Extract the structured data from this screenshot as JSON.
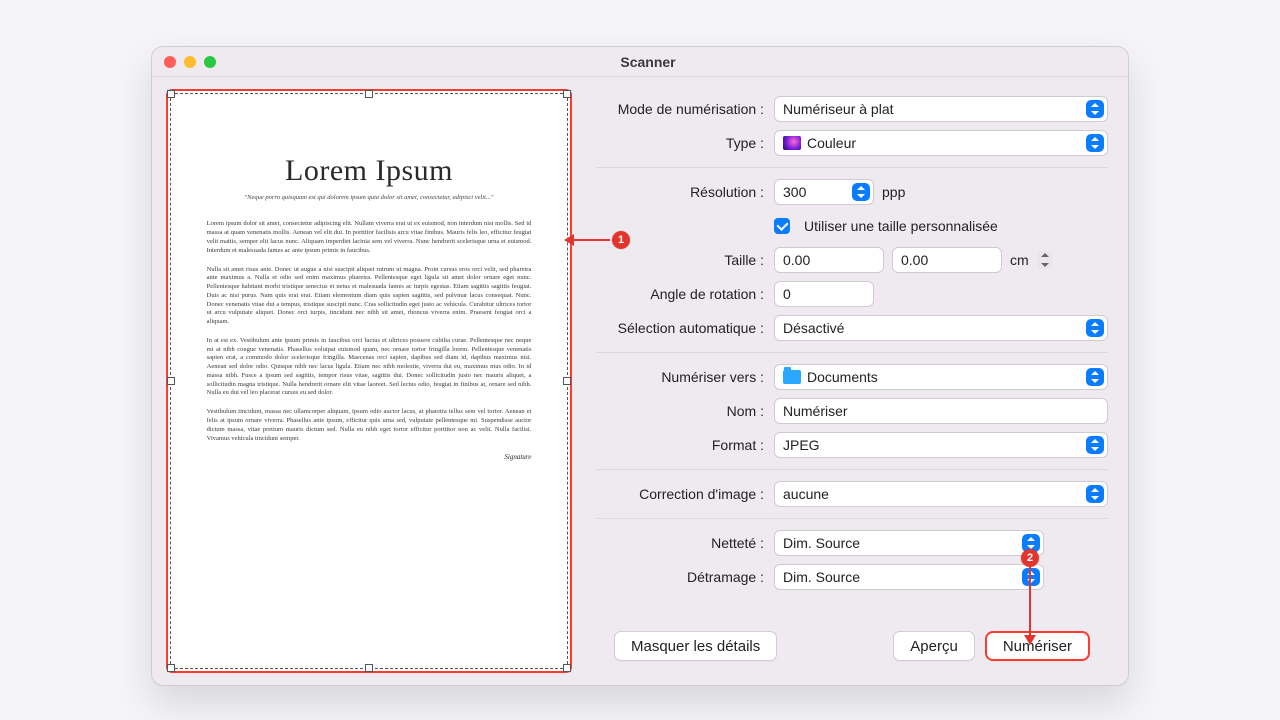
{
  "window": {
    "title": "Scanner"
  },
  "preview": {
    "heading": "Lorem Ipsum",
    "quote": "\"Neque porro quisquam est qui dolorem ipsum quia dolor sit amet, consectetur, adipisci velit...\"",
    "p1": "Lorem ipsum dolor sit amet, consectetur adipiscing elit. Nullam viverra erat ut ex euismod, non interdum nisi mollis. Sed id massa at quam venenatis mollis. Aenean vel elit dui. In porttitor facilisis arcu vitae finibus. Mauris felis leo, efficitur feugiat velit mattis, semper elit lacus nunc. Aliquam imperdiet lacinia sem vel viverra. Nunc hendrerit scelerisque urna et euismod. Interdum et malesuada fames ac ante ipsum primis in faucibus.",
    "p2": "Nulla sit amet risus ante. Donec ut augue a nisi suscipit aliquet rutrum ut magna. Proin cursus eros orci velit, sed pharetra ante maximus a. Nulla et odio sed enim maximus pharetra. Pellentesque eget ligula sit amet dolor ornare eget nunc. Pellentesque habitant morbi tristique senectus et netus et malesuada fames ac turpis egestas. Etiam sagittis sagittis feugiat. Duis ac nisi purus. Nam quis erat erat. Etiam elementum diam quis sapien sagittis, sed pulvinar lacus consequat. Nunc. Donec venenatis vitae dui a tempus, tristique suscipit nunc. Cras sollicitudin eget justo ac vehicula. Curabitur ultrices tortor ut arcu vulputate aliquet. Donec orci turpis, tincidunt nec nibh sit amet, rhoncus viverra enim. Praesent feugiat orci a aliquam.",
    "p3": "In at est ex. Vestibulum ante ipsum primis in faucibus orci luctus et ultrices posuere cubilia curae. Pellentesque nec neque mi at nibh congue venenatis. Phasellus volutpat euismod quam, nec ornare tortor fringilla lorem. Pellentesque venenatis sapien erat, a commodo dolor scelerisque fringilla. Maecenas orci sapien, dapibus sed diam id, dapibus maximus nisi. Aenean sed dolor odio. Quisque nibh nec lacus ligula. Etiam nec nibh molestie, viverra dui eu, maximus mus odio. In id massa nibh. Fusce a ipsum sed sagittis, tempor risus vitae, sagittis dui. Donec sollicitudin justo nec mauris aliquet, a sollicitudin magna tristique. Nulla hendrerit ornare elit vitae laoreet. Sed lectus odio, feugiat in finibus at, ornare sed nibh. Nulla eu dui vel leo placerat cursus eu sed dolor.",
    "p4": "Vestibulum tincidunt, massa nec ullamcorper aliquam, ipsum odio auctor lacus, at pharetra tellus sem vel tortor. Aenean et felis at ipsum ornare viverra. Phasellus ante ipsum, efficitur quis urna sed, vulputate pellentesque mi. Suspendisse auctor dictum massa, vitae pretium mauris dictum sed. Nulla eu nibh eget tortor efficitur porttitor non ac velit. Nulla facilisi. Vivamus vehicula tincidunt semper.",
    "signature": "Signature"
  },
  "labels": {
    "scan_mode": "Mode de numérisation :",
    "type": "Type :",
    "resolution": "Résolution :",
    "use_custom_size": "Utiliser une taille personnalisée",
    "size": "Taille :",
    "rotation": "Angle de rotation :",
    "auto_select": "Sélection automatique :",
    "scan_to": "Numériser vers :",
    "name": "Nom :",
    "format": "Format :",
    "image_correction": "Correction d'image :",
    "sharpness": "Netteté :",
    "descreen": "Détramage :"
  },
  "values": {
    "scan_mode": "Numériseur à plat",
    "type": "Couleur",
    "resolution": "300",
    "resolution_unit": "ppp",
    "size_w": "0.00",
    "size_h": "0.00",
    "size_unit": "cm",
    "rotation": "0",
    "auto_select": "Désactivé",
    "scan_to": "Documents",
    "name": "Numériser",
    "format": "JPEG",
    "image_correction": "aucune",
    "sharpness": "Dim. Source",
    "descreen": "Dim. Source"
  },
  "buttons": {
    "hide_details": "Masquer les détails",
    "overview": "Aperçu",
    "scan": "Numériser"
  },
  "annotations": {
    "a1": "1",
    "a2": "2"
  }
}
